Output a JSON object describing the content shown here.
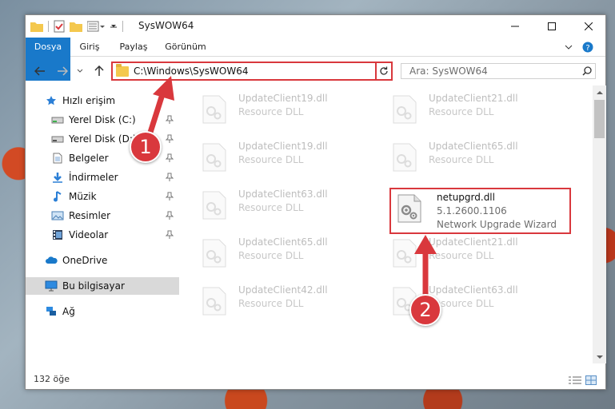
{
  "window": {
    "title": "SysWOW64",
    "controls": {
      "minimize": "—",
      "maximize": "☐",
      "close": "✕"
    }
  },
  "ribbon": {
    "tabs": [
      {
        "label": "Dosya"
      },
      {
        "label": "Giriş"
      },
      {
        "label": "Paylaş"
      },
      {
        "label": "Görünüm"
      }
    ]
  },
  "navbar": {
    "address": "C:\\Windows\\SysWOW64",
    "search_placeholder": "Ara: SysWOW64"
  },
  "sidebar": {
    "items": [
      {
        "label": "Hızlı erişim",
        "icon": "star-icon"
      },
      {
        "label": "Yerel Disk (C:)",
        "icon": "drive-icon",
        "pinned": true
      },
      {
        "label": "Yerel Disk (D:)",
        "icon": "drive-icon",
        "pinned": true
      },
      {
        "label": "Belgeler",
        "icon": "document-icon",
        "pinned": true
      },
      {
        "label": "İndirmeler",
        "icon": "download-icon",
        "pinned": true
      },
      {
        "label": "Müzik",
        "icon": "music-icon",
        "pinned": true
      },
      {
        "label": "Resimler",
        "icon": "pictures-icon",
        "pinned": true
      },
      {
        "label": "Videolar",
        "icon": "video-icon",
        "pinned": true
      },
      {
        "label": "OneDrive",
        "icon": "cloud-icon"
      },
      {
        "label": "Bu bilgisayar",
        "icon": "computer-icon",
        "selected": true
      },
      {
        "label": "Ağ",
        "icon": "network-icon"
      }
    ]
  },
  "files": [
    {
      "name": "UpdateClient19.dll",
      "desc": "Resource DLL"
    },
    {
      "name": "UpdateClient21.dll",
      "desc": "Resource DLL"
    },
    {
      "name": "UpdateClient19.dll",
      "desc": "Resource DLL"
    },
    {
      "name": "UpdateClient65.dll",
      "desc": "Resource DLL"
    },
    {
      "name": "UpdateClient63.dll",
      "desc": "Resource DLL"
    },
    {
      "name": "netupgrd.dll",
      "version": "5.1.2600.1106",
      "desc": "Network Upgrade Wizard",
      "highlighted": true
    },
    {
      "name": "UpdateClient65.dll",
      "desc": "Resource DLL"
    },
    {
      "name": "UpdateClient21.dll",
      "desc": "Resource DLL"
    },
    {
      "name": "UpdateClient42.dll",
      "desc": "Resource DLL"
    },
    {
      "name": "UpdateClient63.dll",
      "desc": "Resource DLL"
    }
  ],
  "status": {
    "count": "132 öğe"
  },
  "annotations": {
    "step1": "1",
    "step2": "2"
  },
  "colors": {
    "accent": "#1979ca",
    "highlight": "#d9383d"
  }
}
